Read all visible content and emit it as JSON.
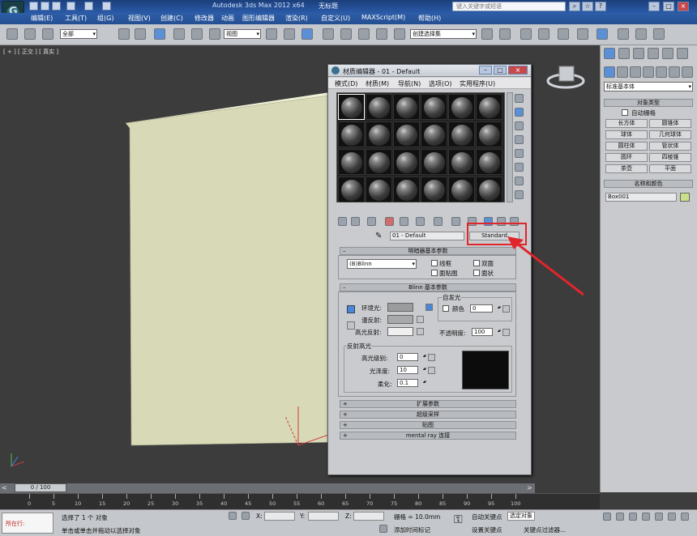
{
  "app": {
    "title": "Autodesk 3ds Max  2012 x64",
    "document": "无标题",
    "search_placeholder": "键入关键字或短语"
  },
  "menubar": [
    "编辑(E)",
    "工具(T)",
    "组(G)",
    "视图(V)",
    "创建(C)",
    "修改器",
    "动画",
    "图形编辑器",
    "渲染(R)",
    "自定义(U)",
    "MAXScript(M)",
    "帮助(H)"
  ],
  "toolbar": {
    "filter": "全部",
    "ref_coord": "视图",
    "named_selection": "创建选择集"
  },
  "viewport": {
    "label": "[ + ] [ 正交 ] [ 真实 ]",
    "box_color": "#d8d9b6"
  },
  "material_editor": {
    "title": "材质编辑器 - 01 - Default",
    "menus": [
      "模式(D)",
      "材质(M)",
      "导航(N)",
      "选项(O)",
      "实用程序(U)"
    ],
    "material_name": "01 - Default",
    "material_type": "Standard",
    "shader_rollout": {
      "title": "明暗器基本参数",
      "shader": "(B)Blinn",
      "options": [
        "线框",
        "双面",
        "面贴图",
        "面状"
      ]
    },
    "blinn_rollout": {
      "title": "Blinn 基本参数",
      "ambient": "环境光:",
      "diffuse": "漫反射:",
      "specular": "高光反射:",
      "self_illum_group": "自发光",
      "color_label": "颜色",
      "self_illum_value": "0",
      "opacity_label": "不透明度:",
      "opacity_value": "100",
      "spec_group": "反射高光",
      "spec_level_label": "高光级别:",
      "spec_level": "0",
      "gloss_label": "光泽度:",
      "gloss": "10",
      "soften_label": "柔化:",
      "soften": "0.1"
    },
    "collapsed_rollouts": [
      "扩展参数",
      "超级采样",
      "贴图",
      "mental ray 连接"
    ]
  },
  "command_panel": {
    "dropdown": "标准基本体",
    "object_type_title": "对象类型",
    "auto_grid": "自动栅格",
    "objects": [
      "长方体",
      "圆锥体",
      "球体",
      "几何球体",
      "圆柱体",
      "管状体",
      "圆环",
      "四棱锥",
      "茶壶",
      "平面"
    ],
    "name_color_title": "名称和颜色",
    "object_name": "Box001",
    "object_color": "#c9e08a"
  },
  "timeline": {
    "frame_display": "0 / 100",
    "ticks": [
      "0",
      "5",
      "10",
      "15",
      "20",
      "25",
      "30",
      "35",
      "40",
      "45",
      "50",
      "55",
      "60",
      "65",
      "70",
      "75",
      "80",
      "85",
      "90",
      "95",
      "100"
    ]
  },
  "statusbar": {
    "script_label": "所在行:",
    "status_line1": "选择了 1 个 对象",
    "status_line2": "单击或单击并拖动以选择对象",
    "x_label": "X:",
    "y_label": "Y:",
    "z_label": "Z:",
    "grid": "栅格 = 10.0mm",
    "auto_key": "自动关键点",
    "set_key": "设置关键点",
    "selected": "选定对象",
    "add_time_tag": "添加时间标记",
    "key_filters": "关键点过滤器..."
  },
  "colors": {
    "highlight": "#e0252b",
    "ambient_swatch": "#9b9c9e",
    "diffuse_swatch": "#a8a9ab",
    "specular_swatch": "#efefef"
  }
}
